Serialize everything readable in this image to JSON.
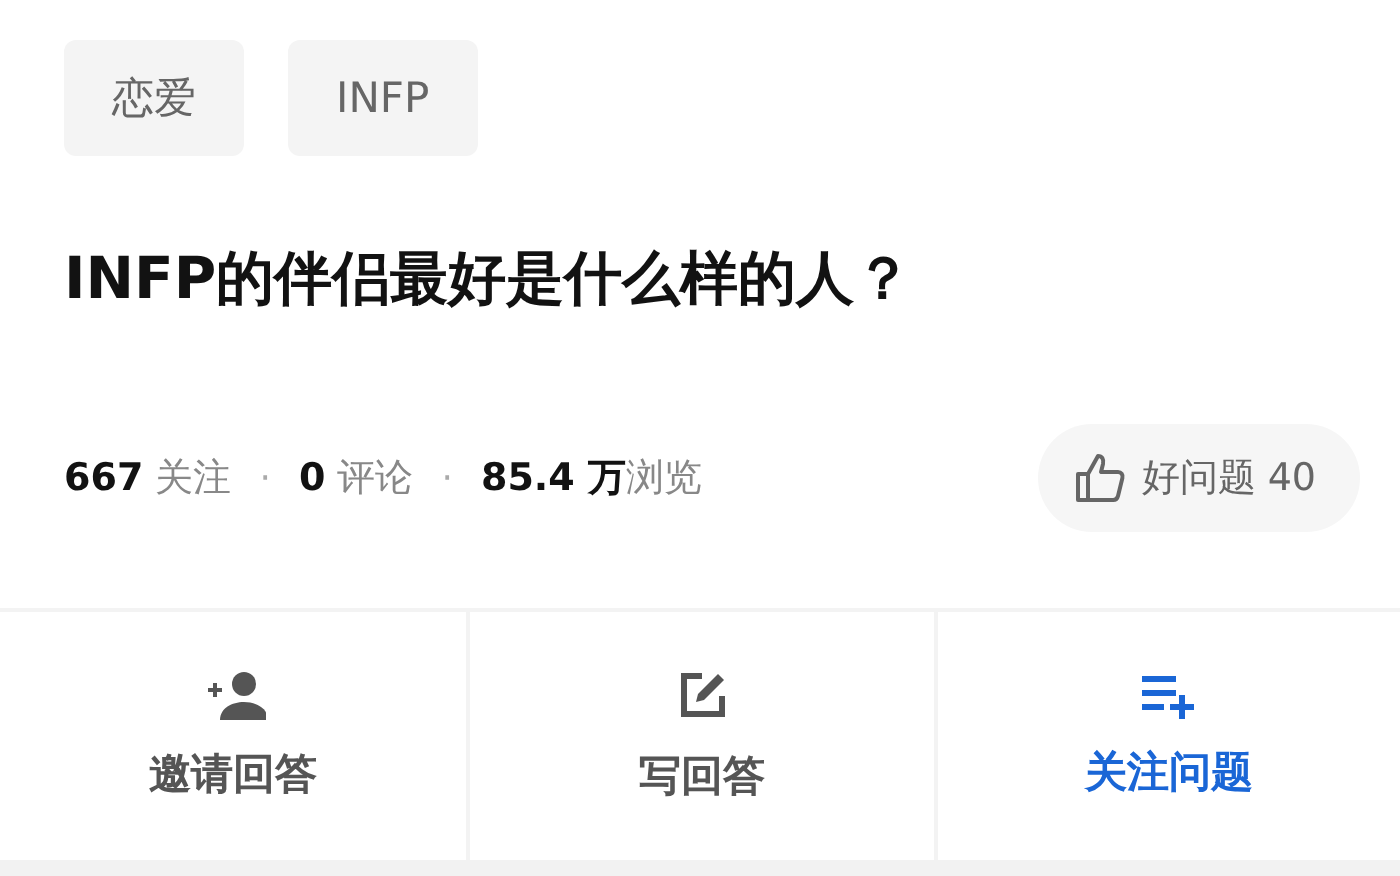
{
  "tags": [
    "恋爱",
    "INFP"
  ],
  "title": "INFP的伴侣最好是什么样的人？",
  "stats": [
    "**667** 关注",
    "**0** 评论",
    "**85.4 万**浏览"
  ],
  "separator": "·",
  "like_button": {
    "label": "好问题 40"
  },
  "actions": [
    {
      "kind": "invite",
      "label": "邀请回答",
      "primary": false
    },
    {
      "kind": "write",
      "label": "写回答",
      "primary": false
    },
    {
      "kind": "follow",
      "label": "关注问题",
      "primary": true
    }
  ]
}
